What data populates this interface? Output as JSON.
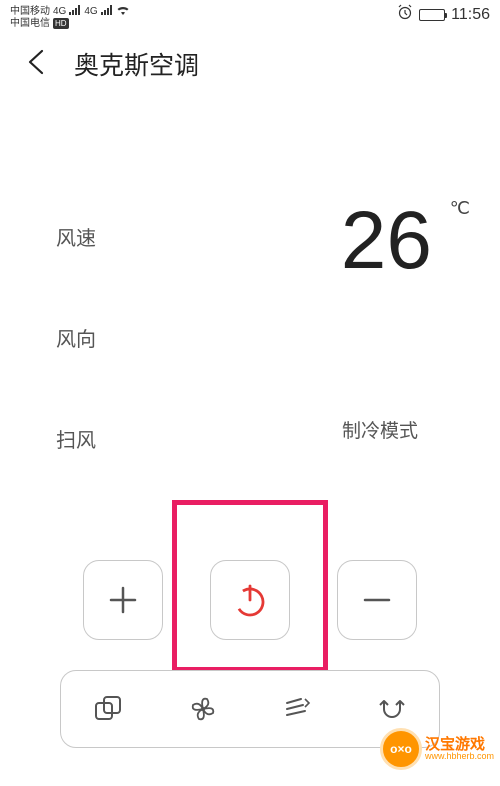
{
  "status": {
    "carrier1": "中国移动",
    "carrier2": "中国电信",
    "hd": "HD",
    "net1": "4G",
    "net2": "4G",
    "time": "11:56"
  },
  "header": {
    "title": "奥克斯空调"
  },
  "panel": {
    "wind_speed_label": "风速",
    "wind_direction_label": "风向",
    "swing_label": "扫风",
    "temperature": "26",
    "temp_unit": "℃",
    "mode": "制冷模式"
  },
  "controls": {
    "plus": "+",
    "power": "power",
    "minus": "−"
  },
  "iconbar": {
    "mode": "mode-icon",
    "fan": "fan-icon",
    "swing": "swing-icon",
    "rotate": "rotate-icon"
  },
  "watermark": {
    "emoji": "o×o",
    "main": "汉宝游戏",
    "sub": "www.hbherb.com"
  }
}
